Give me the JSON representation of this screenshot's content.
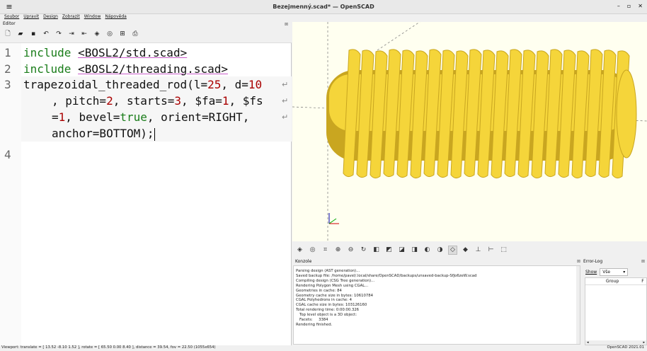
{
  "window": {
    "title": "Bezejmenný.scad* — OpenSCAD",
    "menu_icon": "hamburger-icon"
  },
  "menu": [
    "Soubor",
    "Upravit",
    "Design",
    "Zobrazit",
    "Window",
    "Nápověda"
  ],
  "editor": {
    "title": "Editor",
    "toolbar_icons": [
      "new-icon",
      "open-icon",
      "save-icon",
      "undo-icon",
      "redo-icon",
      "indent-icon",
      "unindent-icon",
      "preview-icon",
      "render-icon",
      "export-stl-icon",
      "send-to-print-icon"
    ],
    "line_numbers": [
      "1",
      "2",
      "3",
      "4"
    ],
    "line1": {
      "kw": "include",
      "arg": "<BOSL2/std.scad>"
    },
    "line2": {
      "kw": "include",
      "arg": "<BOSL2/threading.scad>"
    },
    "line3": {
      "fn": "trapezoidal_threaded_rod(",
      "p1": "l=",
      "v1": "25",
      "p2": ", d=",
      "v2": "10",
      "p3": ", pitch=",
      "v3": "2",
      "p4": ", starts=",
      "v4": "3",
      "p5": ", $fa=",
      "v5": "1",
      "p6": ", $fs",
      "p7": "=",
      "v7": "1",
      "p8": ", bevel=",
      "v8": "true",
      "p9": ", orient=RIGHT,",
      "p10": "anchor=BOTTOM);"
    }
  },
  "viewport_toolbar": [
    "preview-icon",
    "render-icon",
    "view-all-icon",
    "zoom-in-icon",
    "zoom-out-icon",
    "reset-view-icon",
    "view-right-icon",
    "view-top-icon",
    "view-bottom-icon",
    "view-left-icon",
    "view-front-icon",
    "view-back-icon",
    "perspective-icon",
    "orthogonal-icon",
    "show-axes-icon",
    "show-scale-icon",
    "show-edges-icon"
  ],
  "console": {
    "title": "Konzole",
    "lines": [
      "Parsing design (AST generation)...",
      "Saved backup file: /home/pavel/.local/share/OpenSCAD/backups/unsaved-backup-SfJo6zeW.scad",
      "Compiling design (CSG Tree generation)...",
      "Rendering Polygon Mesh using CGAL...",
      "Geometries in cache: 84",
      "Geometry cache size in bytes: 10610784",
      "CGAL Polyhedrons in cache: 4",
      "CGAL cache size in bytes: 103126160",
      "Total rendering time: 0:00:00.326",
      "   Top level object is a 3D object:",
      "   Facets:     3384",
      "Rendering finished."
    ]
  },
  "error_log": {
    "title": "Error-Log",
    "show_label": "Show",
    "show_value": "Vše",
    "col_group": "Group",
    "col_f": "F"
  },
  "status": {
    "left": "Viewport: translate = [ 13.52 -8.10 1.52 ], rotate = [ 65.50 0.00 8.40 ], distance = 39.54, fov = 22.50 (1055x654)",
    "right": "OpenSCAD 2021.01"
  },
  "colors": {
    "model": "#f5d53a",
    "model_shadow": "#c9a620",
    "viewport_bg": "#fffff0",
    "keyword": "#1a7d1a",
    "number": "#aa0000"
  }
}
